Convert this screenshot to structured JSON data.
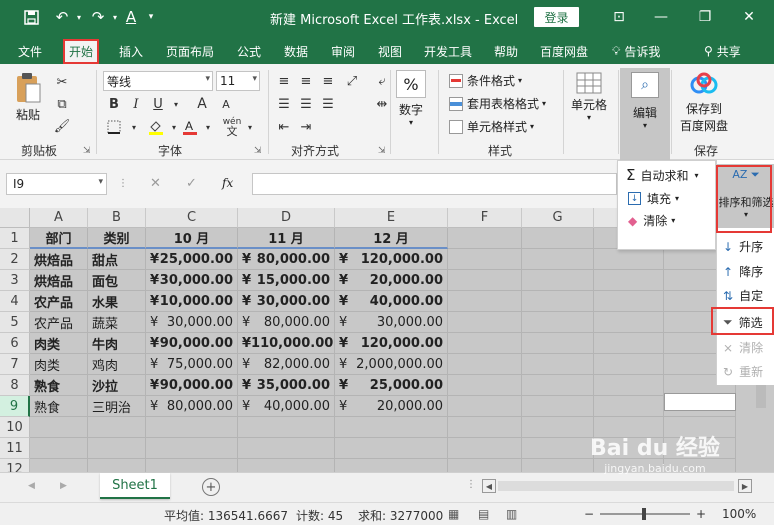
{
  "titlebar": {
    "title": "新建 Microsoft Excel 工作表.xlsx  -  Excel",
    "login": "登录",
    "save_icon": "save-icon",
    "undo_icon": "undo-icon",
    "redo_icon": "redo-icon",
    "font_color_icon": "A",
    "minimize": "—",
    "restore": "❐",
    "close": "✕",
    "ribbon_display": "⊡"
  },
  "tabs": [
    {
      "label": "文件"
    },
    {
      "label": "开始"
    },
    {
      "label": "插入"
    },
    {
      "label": "页面布局"
    },
    {
      "label": "公式"
    },
    {
      "label": "数据"
    },
    {
      "label": "审阅"
    },
    {
      "label": "视图"
    },
    {
      "label": "开发工具"
    },
    {
      "label": "帮助"
    },
    {
      "label": "百度网盘"
    },
    {
      "label": "告诉我"
    },
    {
      "label": "共享"
    }
  ],
  "ribbon": {
    "clipboard": {
      "paste": "粘贴",
      "label": "剪贴板"
    },
    "font": {
      "name": "等线",
      "size": "11",
      "label": "字体",
      "bold": "B",
      "italic": "I",
      "underline": "U",
      "grow": "A",
      "shrink": "A",
      "wen": "wén"
    },
    "align": {
      "label": "对齐方式"
    },
    "number": {
      "label": "数字",
      "symbol": "%"
    },
    "styles": {
      "cond": "条件格式",
      "table": "套用表格格式",
      "cell": "单元格样式",
      "label": "样式"
    },
    "cells": {
      "label": "单元格"
    },
    "edit": {
      "label": "编辑"
    },
    "save": {
      "line1": "保存到",
      "line2": "百度网盘",
      "label": "保存"
    }
  },
  "edit_panel": {
    "autosum": "自动求和",
    "fill": "填充",
    "clear": "清除"
  },
  "sort_panel": {
    "button": "排序和筛选",
    "asc": "升序",
    "desc": "降序",
    "custom": "自定",
    "filter": "筛选",
    "clear": "清除",
    "reapply": "重新"
  },
  "formula_bar": {
    "namebox": "I9",
    "fx": "fx",
    "cancel": "✕",
    "confirm": "✓"
  },
  "grid": {
    "columns": [
      "A",
      "B",
      "C",
      "D",
      "E",
      "F",
      "G"
    ],
    "rows": [
      "1",
      "2",
      "3",
      "4",
      "5",
      "6",
      "7",
      "8",
      "9",
      "10",
      "11",
      "12"
    ],
    "header": [
      "部门",
      "类别",
      "10 月",
      "11 月",
      "12 月"
    ],
    "data": [
      [
        "烘焙品",
        "甜点",
        "25,000.00",
        "80,000.00",
        "120,000.00"
      ],
      [
        "烘焙品",
        "面包",
        "30,000.00",
        "15,000.00",
        "20,000.00"
      ],
      [
        "农产品",
        "水果",
        "10,000.00",
        "30,000.00",
        "40,000.00"
      ],
      [
        "农产品",
        "蔬菜",
        "30,000.00",
        "80,000.00",
        "30,000.00"
      ],
      [
        "肉类",
        "牛肉",
        "90,000.00",
        "110,000.00",
        "120,000.00"
      ],
      [
        "肉类",
        "鸡肉",
        "75,000.00",
        "82,000.00",
        "2,000,000.00"
      ],
      [
        "熟食",
        "沙拉",
        "90,000.00",
        "35,000.00",
        "25,000.00"
      ],
      [
        "熟食",
        "三明治",
        "80,000.00",
        "40,000.00",
        "20,000.00"
      ]
    ],
    "currency": "¥"
  },
  "sheets": {
    "active": "Sheet1",
    "add": "+"
  },
  "status": {
    "average": "平均值: 136541.6667",
    "count": "计数: 45",
    "sum": "求和: 3277000",
    "zoom": "100%"
  },
  "watermark": {
    "brand": "Bai du 经验",
    "url": "jingyan.baidu.com"
  }
}
